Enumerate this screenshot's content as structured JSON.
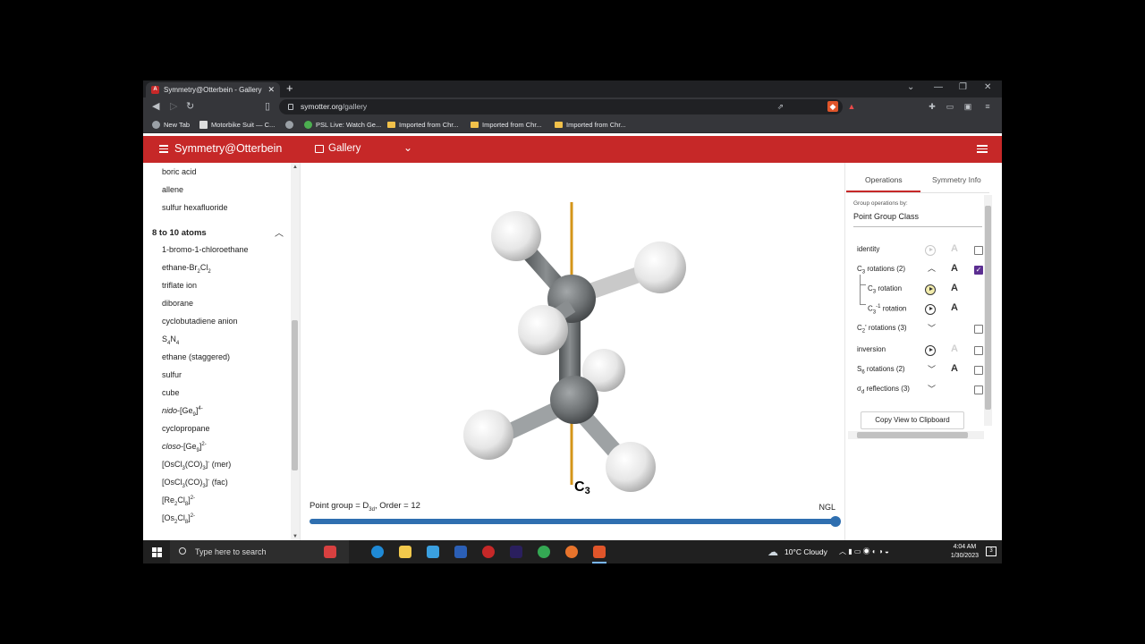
{
  "browser": {
    "tab_title": "Symmetry@Otterbein - Gallery",
    "url_host": "symotter.org",
    "url_path": "/gallery",
    "bookmarks": [
      "New Tab",
      "Motorbike Suit — C...",
      "PSL Live: Watch Ge...",
      "Imported from Chr...",
      "Imported from Chr...",
      "Imported from Chr..."
    ]
  },
  "app": {
    "title": "Symmetry@Otterbein",
    "nav_label": "Gallery"
  },
  "sidebar": {
    "top_items": [
      "boric acid",
      "allene",
      "sulfur hexafluoride"
    ],
    "group_title": "8 to 10 atoms",
    "items": [
      "1-bromo-1-chloroethane",
      "ethane-Br2Cl2",
      "triflate ion",
      "diborane",
      "cyclobutadiene anion",
      "S4N4",
      "ethane (staggered)",
      "sulfur",
      "cube",
      "nido-[Ge9]4-",
      "cyclopropane",
      "closo-[Ge9]2-",
      "[OsCl3(CO)3]- (mer)",
      "[OsCl3(CO)3]- (fac)",
      "[Re2Cl8]2-",
      "[Os2Cl8]2-"
    ]
  },
  "viewer": {
    "axis_label": "C3",
    "point_group_text": "Point group = D3d, Order = 12",
    "renderer": "NGL",
    "slider_value": 1.0
  },
  "panel": {
    "tabs": [
      "Operations",
      "Symmetry Info"
    ],
    "group_by_label": "Group operations by:",
    "group_by_value": "Point Group Class",
    "operations": [
      {
        "label": "identity",
        "checked": false
      },
      {
        "label": "C3 rotations (2)",
        "checked": true,
        "expanded": true
      },
      {
        "label": "C3 rotation",
        "child": true
      },
      {
        "label": "C3-1 rotation",
        "child": true
      },
      {
        "label": "C2' rotations (3)",
        "checked": false
      },
      {
        "label": "inversion",
        "checked": false
      },
      {
        "label": "S6 rotations (2)",
        "checked": false
      },
      {
        "label": "σd reflections (3)",
        "checked": false
      }
    ],
    "copy_button": "Copy View to Clipboard"
  },
  "taskbar": {
    "search_placeholder": "Type here to search",
    "weather": "10°C  Cloudy",
    "time": "4:04 AM",
    "date": "1/30/2023",
    "notifications": "3"
  }
}
